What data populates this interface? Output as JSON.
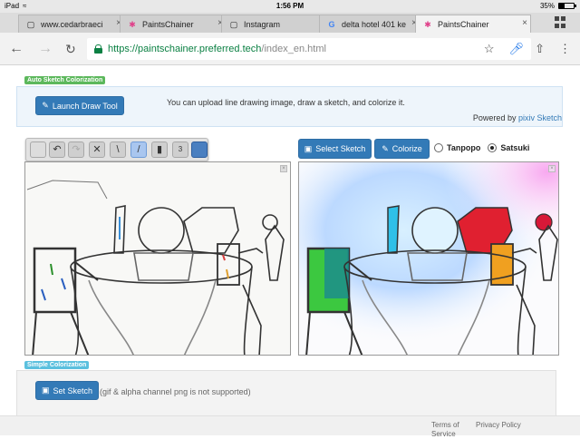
{
  "status_bar": {
    "device": "iPad",
    "time": "1:56 PM",
    "battery": "35%"
  },
  "tabs": [
    {
      "title": "www.cedarbraeci",
      "favicon": "doc-icon",
      "active": false
    },
    {
      "title": "PaintsChainer",
      "favicon": "paintschainer-icon",
      "active": false
    },
    {
      "title": "Instagram",
      "favicon": "doc-icon",
      "active": false
    },
    {
      "title": "delta hotel 401 ke",
      "favicon": "google-icon",
      "active": false
    },
    {
      "title": "PaintsChainer",
      "favicon": "paintschainer-icon",
      "active": true
    }
  ],
  "omnibox": {
    "host": "https://paintschainer.preferred.tech",
    "path": "/index_en.html"
  },
  "sections": {
    "auto": {
      "label": "Auto Sketch Colorization"
    },
    "simple": {
      "label": "Simple Colorization"
    }
  },
  "top_panel": {
    "launch_label": "Launch Draw Tool",
    "description": "You can upload line drawing image, draw a sketch, and colorize it.",
    "powered_by": "Powered by",
    "powered_link": "pixiv Sketch"
  },
  "draw_tools": {
    "brush_size": "3",
    "current_color": "#4a7fc0"
  },
  "controls": {
    "select_sketch_label": "Select Sketch",
    "colorize_label": "Colorize",
    "style_options": [
      {
        "label": "Tanpopo",
        "checked": false
      },
      {
        "label": "Satsuki",
        "checked": true
      }
    ]
  },
  "bottom_panel": {
    "set_sketch_label": "Set Sketch",
    "note": "(gif & alpha channel png is not supported)"
  },
  "footer": {
    "terms": "Terms of Service",
    "privacy": "Privacy Policy"
  },
  "colors": {
    "primary": "#337ab7",
    "label_green": "#5cb85c",
    "label_blue": "#5bc0de",
    "secure": "#0b8043"
  }
}
